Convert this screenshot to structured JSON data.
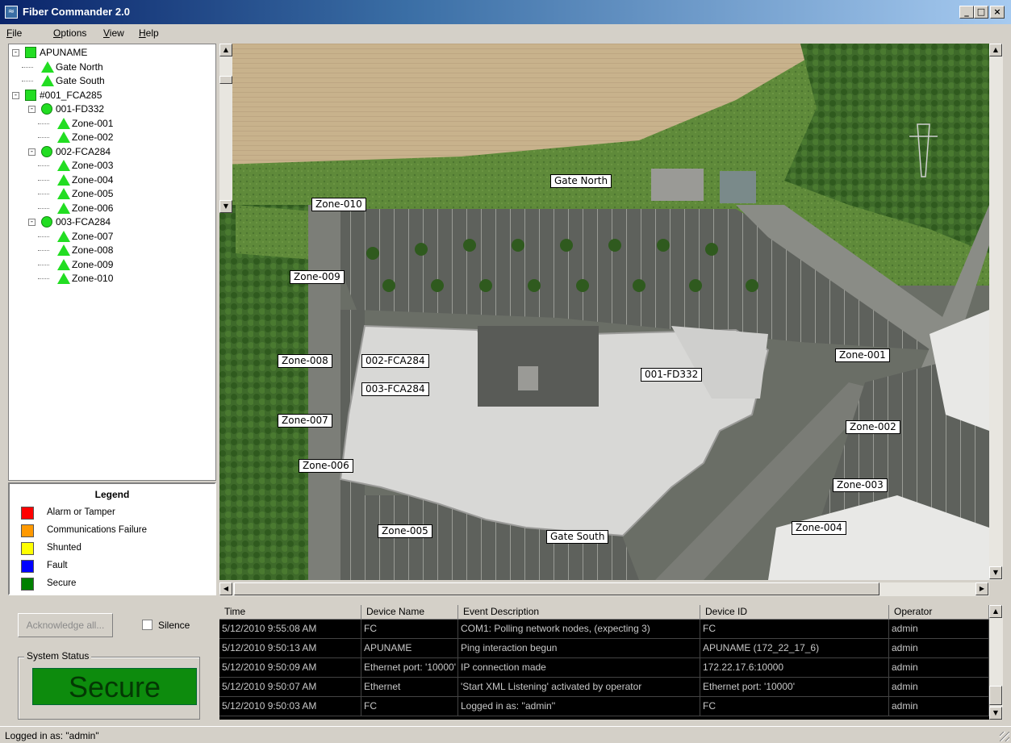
{
  "window": {
    "title": "Fiber Commander 2.0",
    "app_icon": "fiber-app-icon"
  },
  "window_controls": {
    "minimize": "_",
    "maximize": "□",
    "close": "×"
  },
  "menu": [
    {
      "label_u": "F",
      "label_rest": "ile"
    },
    {
      "label_u": "O",
      "label_rest": "ptions"
    },
    {
      "label_u": "V",
      "label_rest": "iew"
    },
    {
      "label_u": "H",
      "label_rest": "elp"
    }
  ],
  "tree": [
    {
      "label": "APUNAME",
      "icon": "square",
      "level": 0,
      "expander": "-"
    },
    {
      "label": "Gate North",
      "icon": "triangle",
      "level": 1
    },
    {
      "label": "Gate South",
      "icon": "triangle",
      "level": 1
    },
    {
      "label": "#001_FCA285",
      "icon": "square",
      "level": 0,
      "expander": "-"
    },
    {
      "label": "001-FD332",
      "icon": "circle",
      "level": 1,
      "expander": "-"
    },
    {
      "label": "Zone-001",
      "icon": "triangle",
      "level": 2
    },
    {
      "label": "Zone-002",
      "icon": "triangle",
      "level": 2
    },
    {
      "label": "002-FCA284",
      "icon": "circle",
      "level": 1,
      "expander": "-"
    },
    {
      "label": "Zone-003",
      "icon": "triangle",
      "level": 2
    },
    {
      "label": "Zone-004",
      "icon": "triangle",
      "level": 2
    },
    {
      "label": "Zone-005",
      "icon": "triangle",
      "level": 2
    },
    {
      "label": "Zone-006",
      "icon": "triangle",
      "level": 2
    },
    {
      "label": "003-FCA284",
      "icon": "circle",
      "level": 1,
      "expander": "-"
    },
    {
      "label": "Zone-007",
      "icon": "triangle",
      "level": 2
    },
    {
      "label": "Zone-008",
      "icon": "triangle",
      "level": 2
    },
    {
      "label": "Zone-009",
      "icon": "triangle",
      "level": 2
    },
    {
      "label": "Zone-010",
      "icon": "triangle",
      "level": 2
    }
  ],
  "status_colors": {
    "ok": "#22dd22"
  },
  "legend": {
    "title": "Legend",
    "items": [
      {
        "label": "Alarm or Tamper",
        "color": "#ff0000"
      },
      {
        "label": "Communications Failure",
        "color": "#ff9900"
      },
      {
        "label": "Shunted",
        "color": "#ffff00"
      },
      {
        "label": "Fault",
        "color": "#0000ff"
      },
      {
        "label": "Secure",
        "color": "#008000"
      }
    ]
  },
  "controls": {
    "acknowledge_label": "Acknowledge all...",
    "silence_label": "Silence",
    "system_status_label": "System Status",
    "status_value": "Secure"
  },
  "map_labels": {
    "gate_north": "Gate North",
    "zone_010": "Zone-010",
    "zone_009": "Zone-009",
    "zone_008": "Zone-008",
    "zone_007": "Zone-007",
    "zone_006": "Zone-006",
    "zone_005": "Zone-005",
    "gate_south": "Gate South",
    "zone_004": "Zone-004",
    "zone_003": "Zone-003",
    "zone_002": "Zone-002",
    "zone_001": "Zone-001",
    "dev_002": "002-FCA284",
    "dev_003": "003-FCA284",
    "dev_001": "001-FD332"
  },
  "events": {
    "columns": [
      "Time",
      "Device Name",
      "Event Description",
      "Device ID",
      "Operator"
    ],
    "rows": [
      [
        "5/12/2010 9:55:08 AM",
        "FC",
        "COM1: Polling network nodes, (expecting 3)",
        "FC",
        "admin"
      ],
      [
        "5/12/2010 9:50:13 AM",
        "APUNAME",
        "Ping interaction begun",
        "APUNAME (172_22_17_6)",
        "admin"
      ],
      [
        "5/12/2010 9:50:09 AM",
        "Ethernet port: '10000'",
        "IP connection made",
        "172.22.17.6:10000",
        "admin"
      ],
      [
        "5/12/2010 9:50:07 AM",
        "Ethernet",
        "'Start XML Listening' activated by operator",
        "Ethernet port: '10000'",
        "admin"
      ],
      [
        "5/12/2010 9:50:03 AM",
        "FC",
        "Logged in as: ''admin''",
        "FC",
        "admin"
      ]
    ]
  },
  "statusbar": {
    "text": "Logged in as: \"admin\""
  }
}
